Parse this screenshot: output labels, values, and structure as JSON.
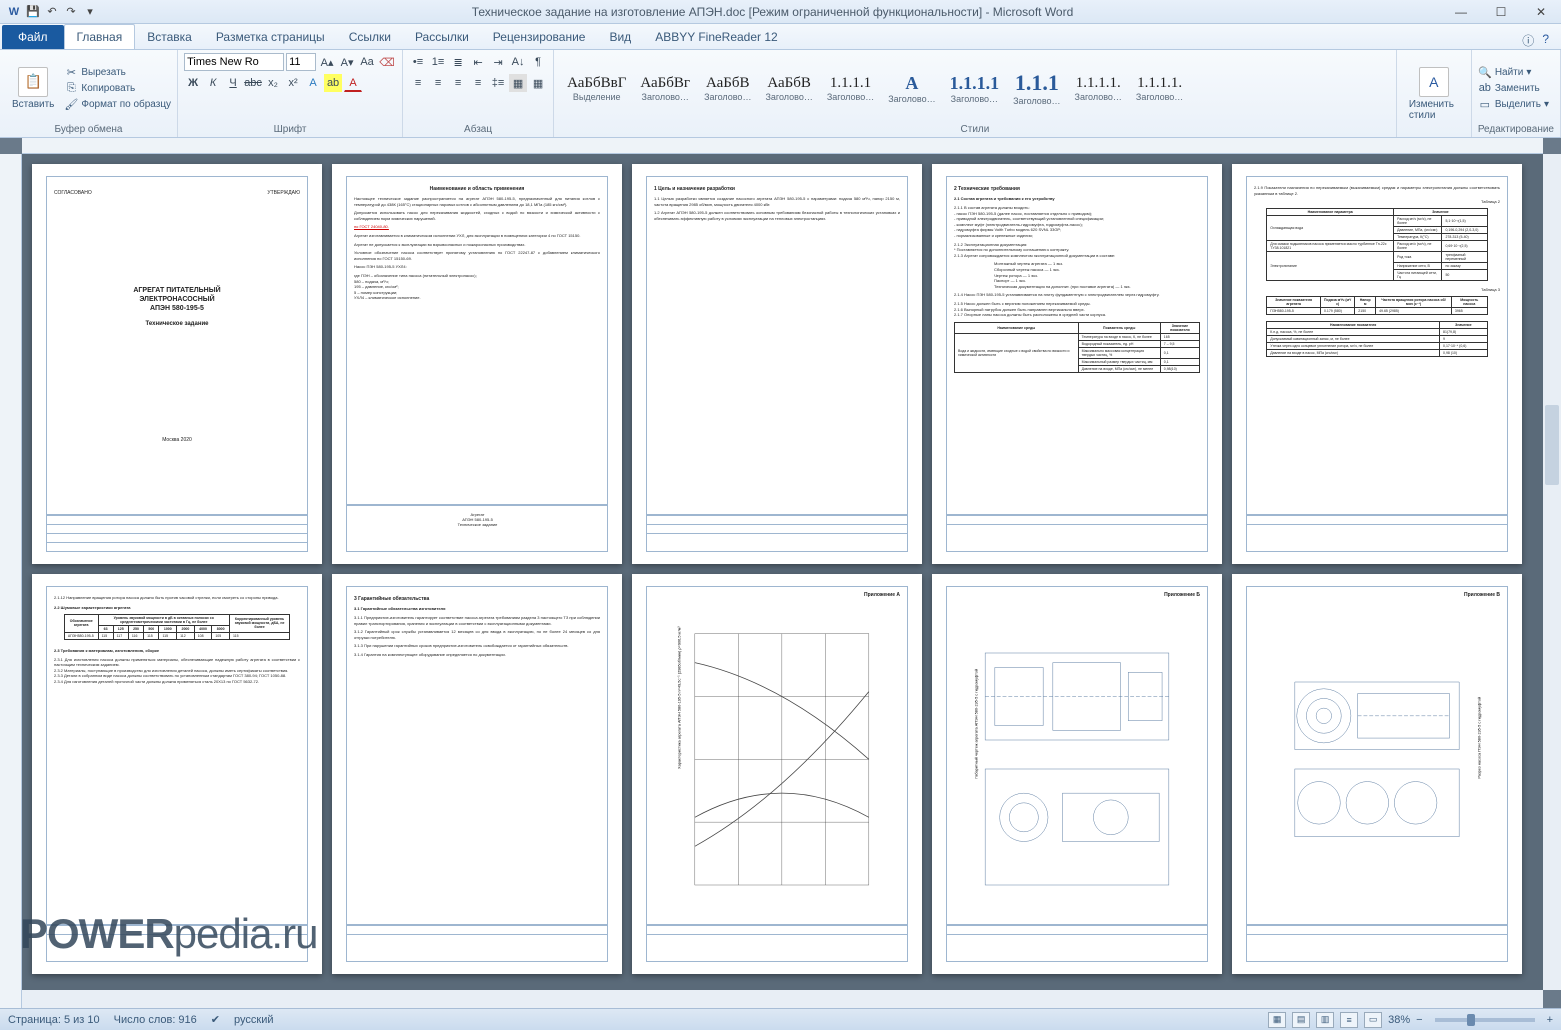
{
  "title": "Техническое задание на изготовление АПЭН.doc [Режим ограниченной функциональности] - Microsoft Word",
  "qat": {
    "save": "💾",
    "undo": "↶",
    "redo": "↷"
  },
  "fileTab": "Файл",
  "tabs": [
    "Главная",
    "Вставка",
    "Разметка страницы",
    "Ссылки",
    "Рассылки",
    "Рецензирование",
    "Вид",
    "ABBYY FineReader 12"
  ],
  "ribbon": {
    "clipboard": {
      "label": "Буфер обмена",
      "paste": "Вставить",
      "cut": "Вырезать",
      "copy": "Копировать",
      "formatPainter": "Формат по образцу"
    },
    "font": {
      "label": "Шрифт",
      "name": "Times New Ro",
      "size": "11"
    },
    "para": {
      "label": "Абзац"
    },
    "styles": {
      "label": "Стили",
      "items": [
        {
          "prev": "АаБбВвГ",
          "name": "Выделение",
          "cls": ""
        },
        {
          "prev": "АаБбВг",
          "name": "Заголово…",
          "cls": ""
        },
        {
          "prev": "АаБбВ",
          "name": "Заголово…",
          "cls": "b"
        },
        {
          "prev": "АаБбВ",
          "name": "Заголово…",
          "cls": ""
        },
        {
          "prev": "1.1.1.1",
          "name": "Заголово…",
          "cls": ""
        },
        {
          "prev": "А",
          "name": "Заголово…",
          "cls": "med"
        },
        {
          "prev": "1.1.1.1",
          "name": "Заголово…",
          "cls": "med"
        },
        {
          "prev": "1.1.1",
          "name": "Заголово…",
          "cls": "big"
        },
        {
          "prev": "1.1.1.1.",
          "name": "Заголово…",
          "cls": ""
        },
        {
          "prev": "1.1.1.1.",
          "name": "Заголово…",
          "cls": ""
        }
      ],
      "change": "Изменить стили"
    },
    "editing": {
      "label": "Редактирование",
      "find": "Найти",
      "replace": "Заменить",
      "select": "Выделить"
    }
  },
  "pages": {
    "p1": {
      "approve_l": "СОГЛАСОВАНО",
      "approve_r": "УТВЕРЖДАЮ",
      "title": "АГРЕГАТ ПИТАТЕЛЬНЫЙ\nЭЛЕКТРОНАСОСНЫЙ\nАПЭН 580-195-5",
      "sub": "Техническое задание",
      "bottom": "Москва 2020"
    },
    "p2": {
      "h": "Наименование и область применения",
      "stamp": "Агрегат\nАПЭН 580-195-5\nТехническое задание"
    },
    "p3": {
      "h": "1  Цель и назначение разработки"
    },
    "p4": {
      "h": "2  Технические требования",
      "h2": "2.1 Состав агрегата и требования к его устройству"
    },
    "p5": {
      "t": "Таблица 2",
      "t2": "Таблица 3"
    },
    "p6": {
      "h": "2.2 Шумовые характеристики агрегата",
      "h2": "2.3 Требования к материалам, изготовлению, сборке"
    },
    "p7": {
      "h": "3  Гарантийные обязательства",
      "h2": "3.1  Гарантийные обязательства изготовителя"
    },
    "p8": {
      "h": "Приложение А"
    },
    "p9": {
      "h": "Приложение Б"
    },
    "p10": {
      "h": "Приложение В"
    }
  },
  "watermark_a": "POWER",
  "watermark_b": "pedia.ru",
  "status": {
    "page": "Страница: 5 из 10",
    "words": "Число слов: 916",
    "lang": "русский",
    "zoom": "38%"
  }
}
